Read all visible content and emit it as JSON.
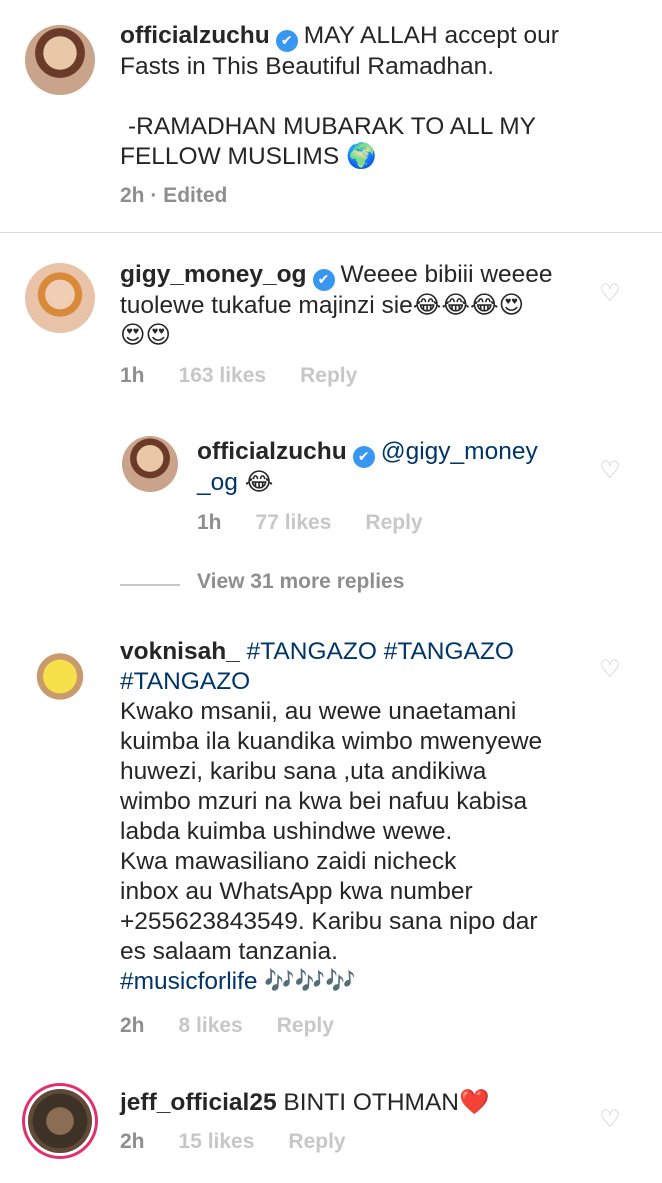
{
  "caption": {
    "username": "officialzuchu",
    "text_line1": "MAY ALLAH accept our",
    "text_line2": "Fasts in This Beautiful Ramadhan.",
    "text_line3": "-RAMADHAN MUBARAK TO ALL MY",
    "text_line4": "FELLOW MUSLIMS 🌍",
    "time": "2h",
    "edited": "· Edited"
  },
  "comments": [
    {
      "username": "gigy_money_og",
      "line1": "Weeee bibiii weeee",
      "line2": "tuolewe tukafue majinzi sie😂😂😂😍",
      "line3": "😍😍",
      "time": "1h",
      "likes": "163 likes",
      "reply": "Reply",
      "heart_icon": "heart-outline"
    },
    {
      "username": "officialzuchu",
      "mention": "@gigy_money",
      "mention_cont": "_og",
      "emoji": "😂",
      "time": "1h",
      "likes": "77 likes",
      "reply": "Reply",
      "heart_icon": "heart-outline"
    },
    {
      "username": "voknisah_",
      "tags1": "#TANGAZO #TANGAZO",
      "tags2": "#TANGAZO",
      "body": [
        "Kwako msanii, au wewe unaetamani",
        "kuimba ila kuandika wimbo mwenyewe",
        "huwezi, karibu sana ,uta andikiwa",
        "wimbo mzuri na kwa bei nafuu kabisa",
        "labda kuimba ushindwe wewe.",
        "Kwa mawasiliano zaidi nicheck",
        "inbox au WhatsApp kwa number",
        "+255623843549. Karibu  sana nipo dar",
        "es salaam tanzania."
      ],
      "tag_last": "#musicforlife",
      "tag_emoji": "🎶🎶🎶",
      "time": "2h",
      "likes": "8 likes",
      "reply": "Reply",
      "heart_icon": "heart-outline"
    },
    {
      "username": "jeff_official25",
      "text": "BINTI OTHMAN❤️",
      "time": "2h",
      "likes": "15 likes",
      "reply": "Reply",
      "heart_icon": "heart-outline"
    }
  ],
  "view_replies": "View 31 more replies",
  "colors": {
    "text": "#262626",
    "muted": "#8e8e8e",
    "faint": "#c7c7c7",
    "hashtag": "#003569",
    "verified": "#3897f0",
    "story_ring": "#e1306c"
  }
}
